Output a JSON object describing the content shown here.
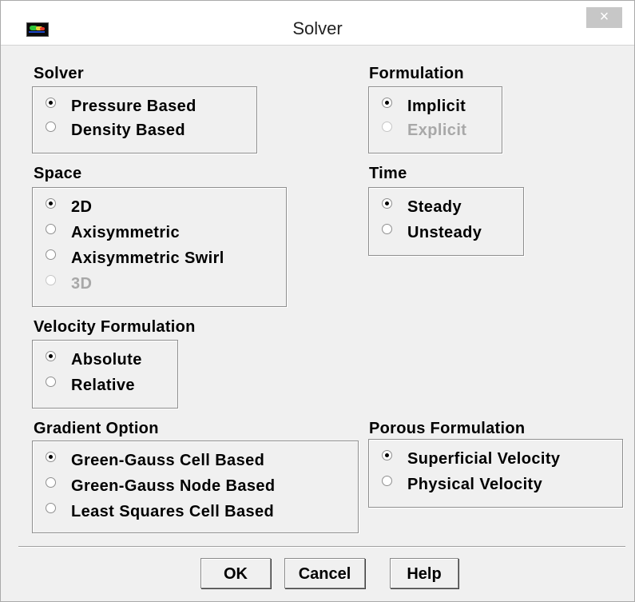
{
  "window": {
    "title": "Solver",
    "close_label": "×"
  },
  "solver": {
    "label": "Solver",
    "options": [
      "Pressure Based",
      "Density Based"
    ],
    "selected": 0
  },
  "formulation": {
    "label": "Formulation",
    "options": [
      "Implicit",
      "Explicit"
    ],
    "selected": 0,
    "disabled": [
      1
    ]
  },
  "space": {
    "label": "Space",
    "options": [
      "2D",
      "Axisymmetric",
      "Axisymmetric Swirl",
      "3D"
    ],
    "selected": 0,
    "disabled": [
      3
    ]
  },
  "time": {
    "label": "Time",
    "options": [
      "Steady",
      "Unsteady"
    ],
    "selected": 0
  },
  "velocity": {
    "label": "Velocity Formulation",
    "options": [
      "Absolute",
      "Relative"
    ],
    "selected": 0
  },
  "gradient": {
    "label": "Gradient Option",
    "options": [
      "Green-Gauss Cell Based",
      "Green-Gauss Node Based",
      "Least Squares Cell Based"
    ],
    "selected": 0
  },
  "porous": {
    "label": "Porous Formulation",
    "options": [
      "Superficial Velocity",
      "Physical Velocity"
    ],
    "selected": 0
  },
  "buttons": {
    "ok": "OK",
    "cancel": "Cancel",
    "help": "Help"
  }
}
